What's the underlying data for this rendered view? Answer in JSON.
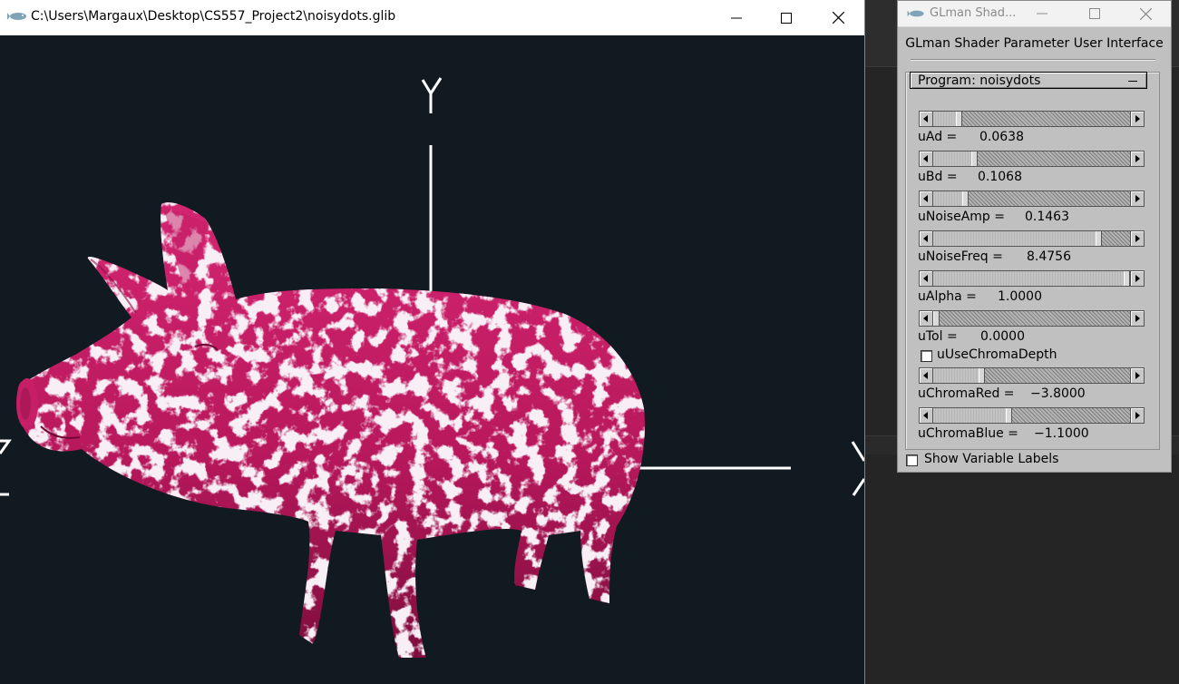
{
  "main_window": {
    "title": "C:\\Users\\Margaux\\Desktop\\CS557_Project2\\noisydots.glib",
    "axis_label_y": "Y"
  },
  "panel": {
    "title": "GLman Shad...",
    "heading": "GLman Shader Parameter User Interface",
    "program_label": "Program: noisydots",
    "params": [
      {
        "name": "uAd",
        "value": "0.0638",
        "level": 0.12
      },
      {
        "name": "uBd",
        "value": "0.1068",
        "level": 0.2
      },
      {
        "name": "uNoiseAmp",
        "value": "0.1463",
        "level": 0.15
      },
      {
        "name": "uNoiseFreq",
        "value": "8.4756",
        "level": 0.85
      },
      {
        "name": "uAlpha",
        "value": "1.0000",
        "level": 1.0
      },
      {
        "name": "uTol",
        "value": "0.0000",
        "level": 0.0
      },
      {
        "name": "uChromaRed",
        "value": "−3.8000",
        "level": 0.24
      },
      {
        "name": "uChromaBlue",
        "value": "−1.1000",
        "level": 0.38
      }
    ],
    "chroma_depth_label": "uUseChromaDepth",
    "show_labels": "Show Variable Labels"
  },
  "colors": {
    "scene_bg": "#121a21",
    "pig_pink": "#c11b62",
    "pig_spots": "#e6d3e4",
    "panel_bg": "#c0c0c0"
  }
}
